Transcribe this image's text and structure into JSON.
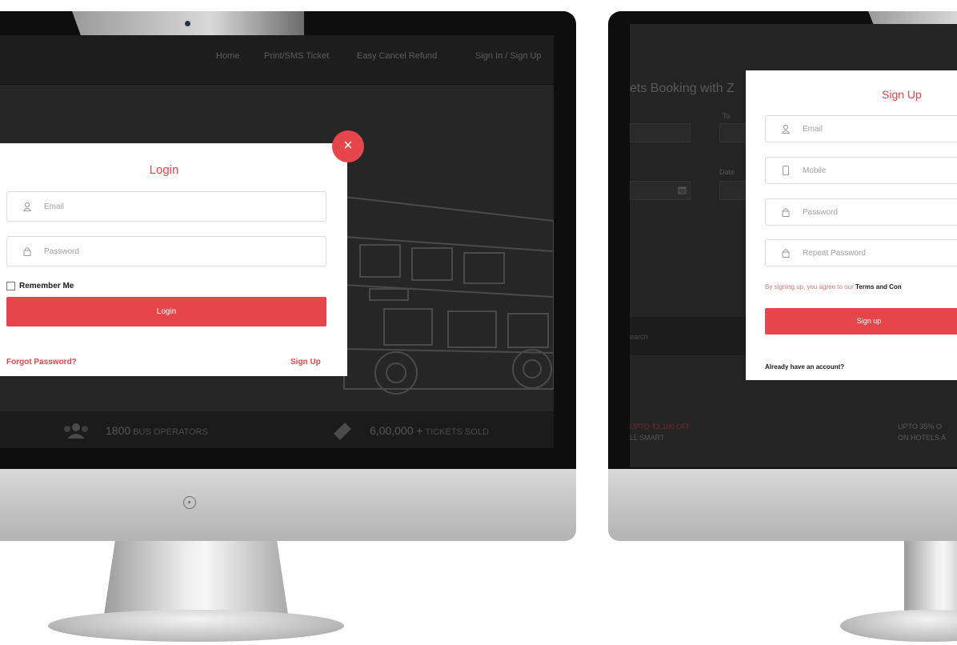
{
  "left_screen": {
    "nav": {
      "links": [
        "Home",
        "Print/SMS Ticket",
        "Easy Cancel Refund"
      ],
      "auth": "Sign In / Sign Up"
    },
    "stats": [
      {
        "value": "1800",
        "label": "BUS OPERATORS"
      },
      {
        "value": "6,00,000 +",
        "label": "TICKETS SOLD"
      }
    ],
    "login_modal": {
      "title": "Login",
      "email_placeholder": "Email",
      "password_placeholder": "Password",
      "remember_label": "Remember Me",
      "submit_label": "Login",
      "forgot_label": "Forgot Password?",
      "signup_link": "Sign Up",
      "close_symbol": "×"
    }
  },
  "right_screen": {
    "heading": "ets Booking with Z",
    "labels": {
      "to": "To",
      "date": "Date"
    },
    "band_text": "earch",
    "promos": [
      "UPTO ₹3,100 OFF",
      "LL SMART",
      "UPTO 35% O",
      "ON HOTELS A"
    ],
    "signup_modal": {
      "title": "Sign Up",
      "email_placeholder": "Email",
      "mobile_placeholder": "Mobile",
      "password_placeholder": "Password",
      "repeat_password_placeholder": "Repeat Password",
      "terms_prefix": "By signing up, you agree to our",
      "terms_link": "Terms and Con",
      "submit_label": "Sign up",
      "already_label": "Already have an account?"
    }
  },
  "colors": {
    "accent": "#e6454b",
    "screen_bg": "#242424",
    "bezel": "#0e0e0e"
  },
  "icons": [
    "user-icon",
    "lock-icon",
    "mobile-icon",
    "close-icon",
    "calendar-icon",
    "users-icon",
    "ticket-icon",
    "power-icon",
    "camera-dot"
  ]
}
